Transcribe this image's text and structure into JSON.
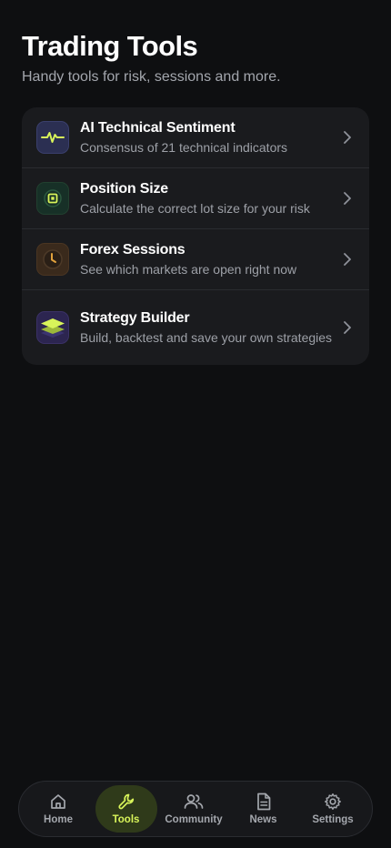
{
  "header": {
    "title": "Trading Tools",
    "subtitle": "Handy tools for risk, sessions and more."
  },
  "tools": [
    {
      "title": "AI Technical Sentiment",
      "desc": "Consensus of 21 technical indicators",
      "icon": "pulse-icon"
    },
    {
      "title": "Position Size",
      "desc": "Calculate the correct lot size for your risk",
      "icon": "target-chip-icon"
    },
    {
      "title": "Forex Sessions",
      "desc": "See which markets are open right now",
      "icon": "clock-icon"
    },
    {
      "title": "Strategy Builder",
      "desc": "Build, backtest and save your own strategies",
      "icon": "layers-icon"
    }
  ],
  "tabbar": {
    "tabs": [
      {
        "label": "Home",
        "icon": "home-icon",
        "active": false
      },
      {
        "label": "Tools",
        "icon": "wrench-icon",
        "active": true
      },
      {
        "label": "Community",
        "icon": "users-icon",
        "active": false
      },
      {
        "label": "News",
        "icon": "document-icon",
        "active": false
      },
      {
        "label": "Settings",
        "icon": "gear-icon",
        "active": false
      }
    ]
  },
  "colors": {
    "background": "#0e0f11",
    "card": "#1a1b1e",
    "accent": "#d8f45a",
    "muted_text": "#9da0a7"
  }
}
